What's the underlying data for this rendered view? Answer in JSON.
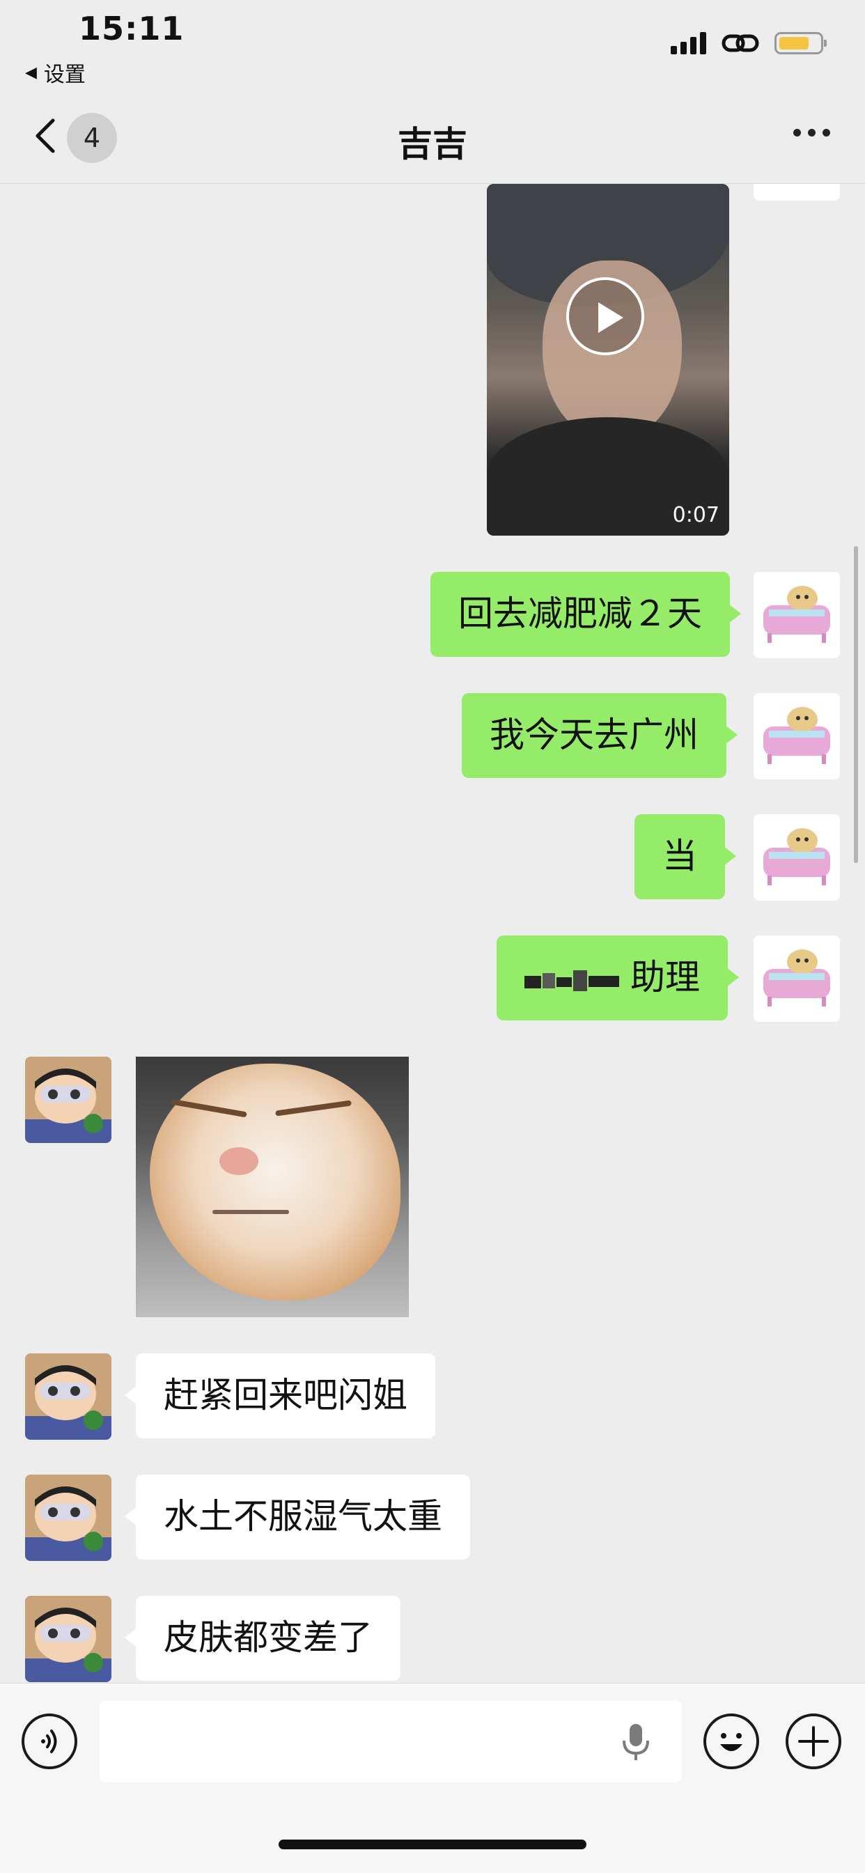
{
  "status_bar": {
    "time": "15:11",
    "back_app_label": "设置",
    "battery_color": "#f5c542"
  },
  "nav": {
    "unread_count": "4",
    "title": "吉吉",
    "more_icon": "ellipsis-icon"
  },
  "messages": {
    "video": {
      "duration": "0:07"
    },
    "m1": {
      "text": "回去减肥减２天"
    },
    "m2": {
      "text": "我今天去广州"
    },
    "m3": {
      "text": "当"
    },
    "m4": {
      "suffix": "助理"
    },
    "r1": {
      "text": "赶紧回来吧闪姐"
    },
    "r2": {
      "text": "水土不服湿气太重"
    },
    "r3": {
      "text": "皮肤都变差了"
    }
  },
  "colors": {
    "my_bubble": "#95ec69",
    "other_bubble": "#ffffff",
    "background": "#ededed"
  },
  "input_bar": {
    "placeholder": "",
    "voice_icon": "voice-icon",
    "emoji_icon": "emoji-icon",
    "plus_icon": "plus-icon"
  }
}
